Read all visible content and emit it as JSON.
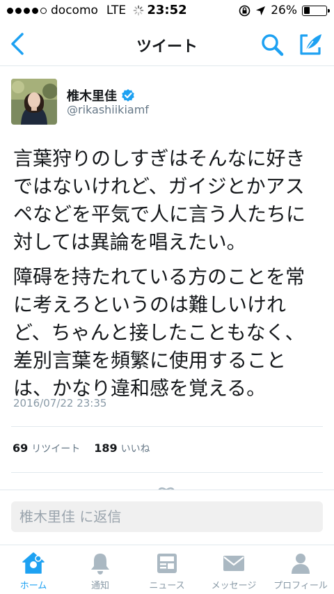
{
  "status_bar": {
    "carrier": "docomo",
    "network": "LTE",
    "time": "23:52",
    "battery_percent": "26%",
    "battery_level": 0.26
  },
  "nav": {
    "title": "ツイート"
  },
  "tweet": {
    "author_name": "椎木里佳",
    "author_handle": "@rikashiikiamf",
    "verified": true,
    "paragraph1": [
      "言葉狩りのしすぎはそんなに好き",
      "ではないけれど、ガイジとかアス",
      "ペなどを平気で人に言う人たちに",
      "対しては異論を唱えたい。"
    ],
    "paragraph2": [
      "障碍を持たれている方のことを常",
      "に考えろというのは難しいけれ",
      "ど、ちゃんと接したこともなく、",
      "差別言葉を頻繁に使用すること",
      "は、かなり違和感を覚える。"
    ],
    "timestamp": "2016/07/22 23:35",
    "retweet_count": "69",
    "retweet_label": "リツイート",
    "like_count": "189",
    "like_label": "いいね"
  },
  "reply": {
    "placeholder": "椎木里佳 に返信"
  },
  "tabbar": {
    "home": "ホーム",
    "notifications": "通知",
    "news": "ニュース",
    "messages": "メッセージ",
    "profile": "プロフィール"
  },
  "colors": {
    "accent": "#1da1f2",
    "text": "#14171a",
    "secondary": "#657786",
    "muted": "#8899a6",
    "icon_gray": "#aab8c2",
    "divider": "#e1e8ed"
  }
}
